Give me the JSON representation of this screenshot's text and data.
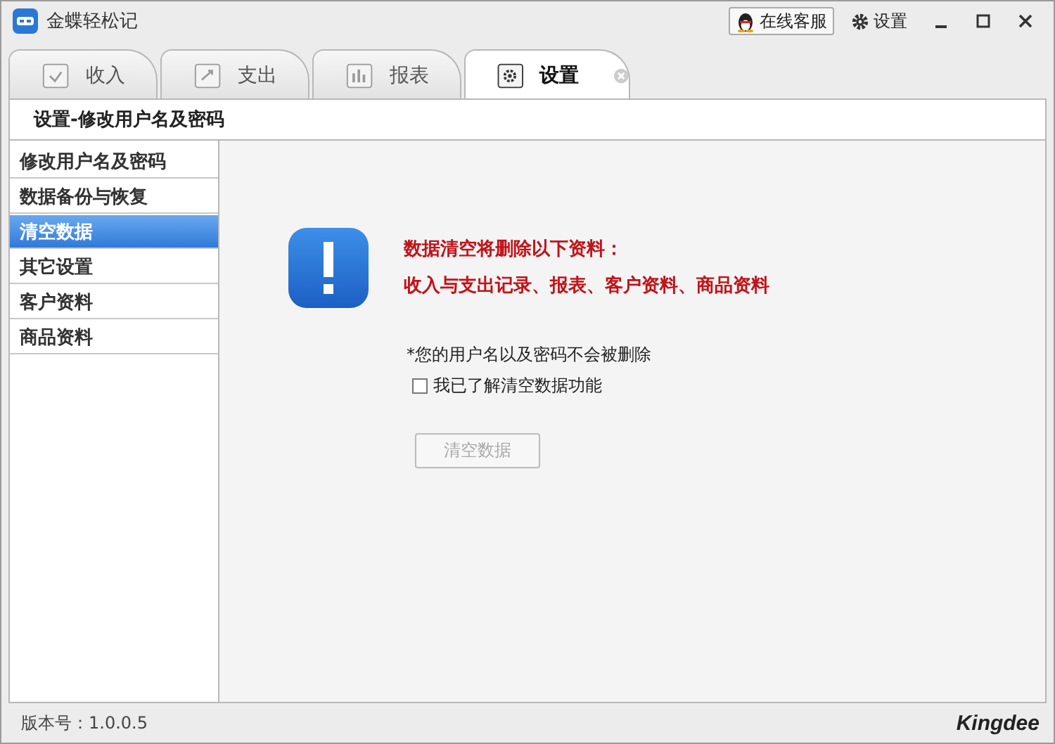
{
  "window": {
    "title": "金蝶轻松记"
  },
  "title_bar": {
    "support_button": "在线客服",
    "settings_button": "设置"
  },
  "tabs": [
    {
      "label": "收入",
      "kind": "income",
      "selected": false,
      "closable": false
    },
    {
      "label": "支出",
      "kind": "expense",
      "selected": false,
      "closable": false
    },
    {
      "label": "报表",
      "kind": "report",
      "selected": false,
      "closable": false
    },
    {
      "label": "设置",
      "kind": "settings",
      "selected": true,
      "closable": true
    }
  ],
  "page_header": "设置-修改用户名及密码",
  "sidebar": {
    "items": [
      {
        "label": "修改用户名及密码",
        "selected": false
      },
      {
        "label": "数据备份与恢复",
        "selected": false
      },
      {
        "label": "清空数据",
        "selected": true
      },
      {
        "label": "其它设置",
        "selected": false
      },
      {
        "label": "客户资料",
        "selected": false
      },
      {
        "label": "商品资料",
        "selected": false
      }
    ]
  },
  "warning": {
    "lines": [
      "数据清空将删除以下资料：",
      "收入与支出记录、报表、客户资料、商品资料"
    ]
  },
  "note": "*您的用户名以及密码不会被删除",
  "confirm_checkbox": {
    "label": "我已了解清空数据功能",
    "checked": false
  },
  "clear_button": {
    "label": "清空数据",
    "disabled": true
  },
  "status_bar": {
    "version": "版本号：1.0.0.5",
    "brand": "Kingdee"
  }
}
